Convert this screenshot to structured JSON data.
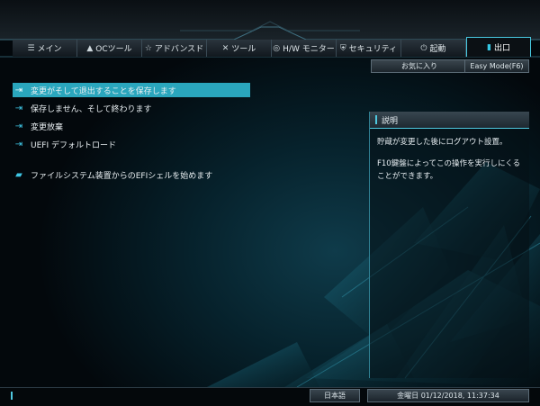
{
  "tabs": [
    {
      "label": "メイン",
      "icon": "menu-list-icon"
    },
    {
      "label": "OCツール",
      "icon": "rocket-icon"
    },
    {
      "label": "アドバンスド",
      "icon": "star-icon"
    },
    {
      "label": "ツール",
      "icon": "tools-icon"
    },
    {
      "label": "H/W モニター",
      "icon": "monitor-icon"
    },
    {
      "label": "セキュリティ",
      "icon": "shield-icon"
    },
    {
      "label": "起動",
      "icon": "power-icon"
    },
    {
      "label": "出口",
      "icon": "exit-icon",
      "active": true
    }
  ],
  "sub_buttons": {
    "favorites": "お気に入り",
    "easy_mode": "Easy Mode(F6)"
  },
  "menu_items": [
    {
      "label": "変更がそして退出することを保存します",
      "icon": "exit-door-icon",
      "selected": true
    },
    {
      "label": "保存しません、そして終わります",
      "icon": "exit-door-icon"
    },
    {
      "label": "変更放棄",
      "icon": "exit-door-icon"
    },
    {
      "label": "UEFI デフォルトロード",
      "icon": "exit-door-icon"
    },
    {
      "label": "ファイルシステム装置からのEFIシェルを始めます",
      "icon": "folder-icon"
    }
  ],
  "description": {
    "title": "説明",
    "lines": [
      "貯蔵が変更した後にログアウト設置。",
      "F10鍵盤によってこの操作を実行しにくることができます。"
    ]
  },
  "footer": {
    "language": "日本語",
    "datetime": "金曜日 01/12/2018, 11:37:34"
  },
  "colors": {
    "accent": "#2aa6bd",
    "highlight": "#4fc8df"
  }
}
